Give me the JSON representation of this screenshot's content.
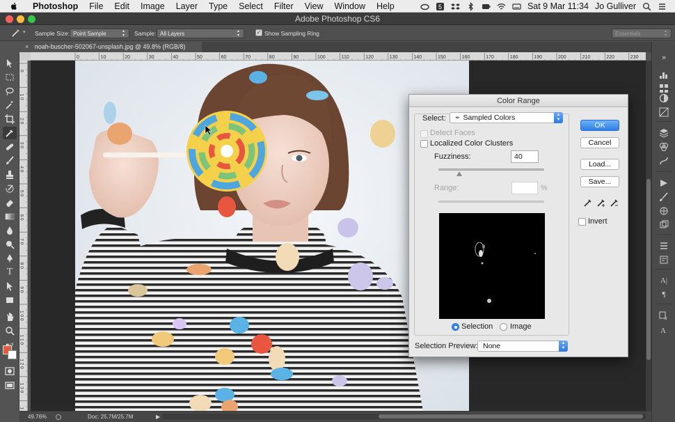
{
  "menubar": {
    "app": "Photoshop",
    "items": [
      "File",
      "Edit",
      "Image",
      "Layer",
      "Type",
      "Select",
      "Filter",
      "View",
      "Window",
      "Help"
    ],
    "datetime": "Sat 9 Mar  11:34",
    "user": "Jo Gulliver"
  },
  "window": {
    "title": "Adobe Photoshop CS6"
  },
  "options": {
    "sample_size_label": "Sample Size:",
    "sample_size_value": "Point Sample",
    "sample_label": "Sample:",
    "sample_value": "All Layers",
    "show_ring_label": "Show Sampling Ring",
    "workspace": "Essentials"
  },
  "document": {
    "tab_title": "noah-buscher-502067-unsplash.jpg @ 49.8% (RGB/8)",
    "zoom": "49.76%",
    "doc_size": "Doc: 25.7M/25.7M"
  },
  "ruler": {
    "top": [
      "0",
      "10",
      "20",
      "30",
      "40",
      "50",
      "60",
      "70",
      "80",
      "90",
      "100",
      "110",
      "120",
      "130",
      "140",
      "150",
      "160",
      "170",
      "180",
      "190",
      "200",
      "210",
      "220",
      "230"
    ],
    "left": [
      "0",
      "10",
      "20",
      "30",
      "40",
      "50",
      "60",
      "70",
      "80",
      "90",
      "100",
      "110",
      "120",
      "130",
      "140"
    ]
  },
  "dialog": {
    "title": "Color Range",
    "select_label": "Select:",
    "select_value": "Sampled Colors",
    "detect_faces": "Detect Faces",
    "localized": "Localized Color Clusters",
    "fuzziness_label": "Fuzziness:",
    "fuzziness_value": "40",
    "fuzziness": 0.2,
    "range_label": "Range:",
    "range_unit": "%",
    "selection_label": "Selection",
    "image_label": "Image",
    "preview_label": "Selection Preview:",
    "preview_value": "None",
    "ok": "OK",
    "cancel": "Cancel",
    "load": "Load...",
    "save": "Save...",
    "invert": "Invert"
  },
  "colors": {
    "foreground": "#e65a3a",
    "background": "#ffffff",
    "accent": "#2f7fe6"
  }
}
